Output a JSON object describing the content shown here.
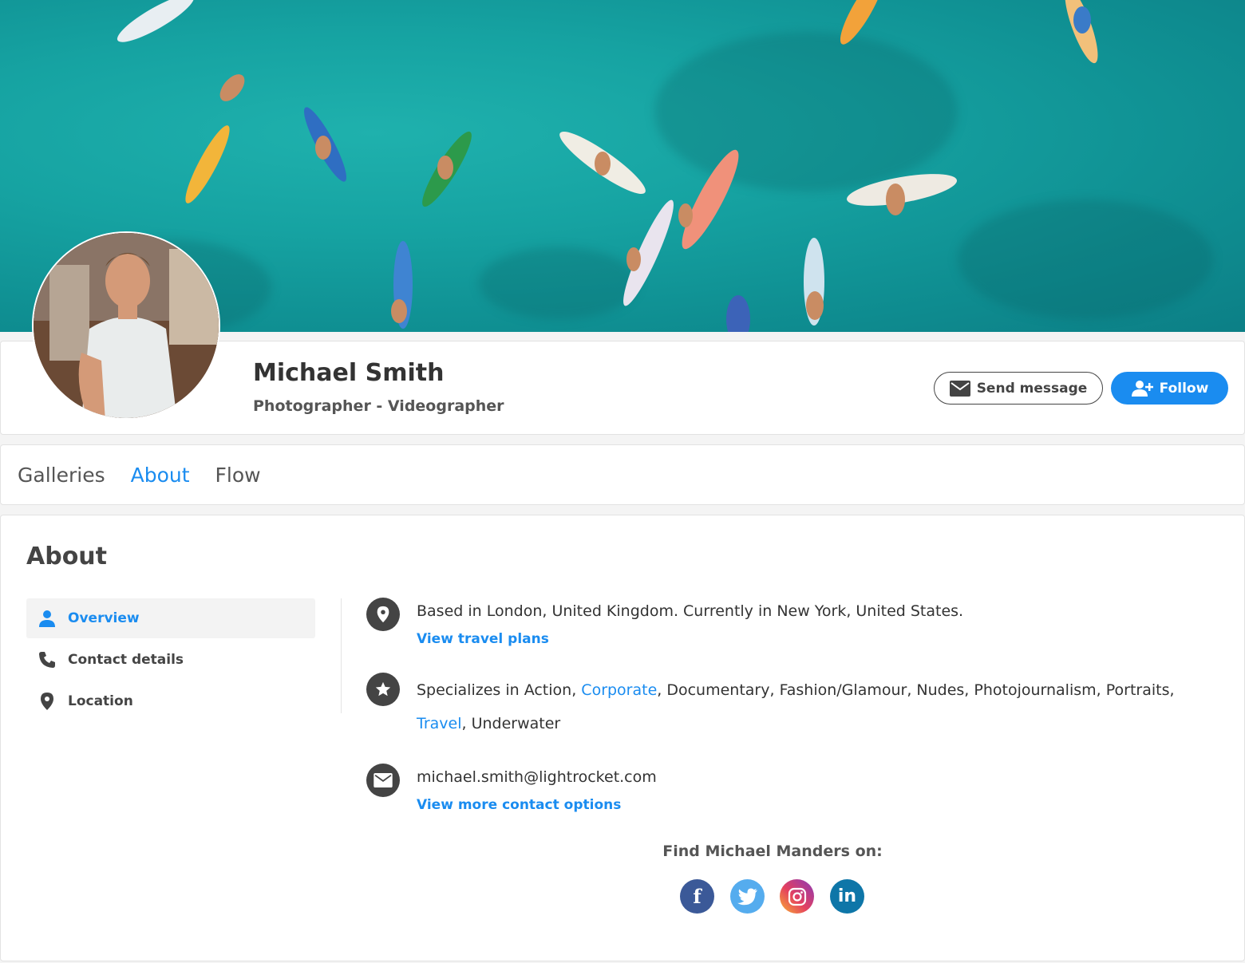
{
  "profile": {
    "name": "Michael Smith",
    "role": "Photographer - Videographer",
    "send_message_label": "Send message",
    "follow_label": "Follow"
  },
  "tabs": [
    {
      "label": "Galleries",
      "active": false
    },
    {
      "label": "About",
      "active": true
    },
    {
      "label": "Flow",
      "active": false
    }
  ],
  "about": {
    "title": "About",
    "sidebar": [
      {
        "label": "Overview",
        "icon": "person-icon",
        "active": true
      },
      {
        "label": "Contact details",
        "icon": "phone-icon",
        "active": false
      },
      {
        "label": "Location",
        "icon": "location-pin-icon",
        "active": false
      }
    ],
    "location_text": "Based in London, United Kingdom. Currently in New York, United States.",
    "travel_link": "View travel plans",
    "specializes_prefix": "Specializes in  Action, ",
    "spec_corporate": "Corporate",
    "spec_middle": ", Documentary, Fashion/Glamour, Nudes, Photojournalism, Portraits,",
    "spec_travel": "Travel",
    "spec_end": ", Underwater",
    "email": "michael.smith@lightrocket.com",
    "contact_link": "View more contact options",
    "find_label": "Find Michael Manders on:",
    "social": [
      "facebook-icon",
      "twitter-icon",
      "instagram-icon",
      "linkedin-icon"
    ]
  },
  "colors": {
    "accent": "#1a8cf0",
    "facebook": "#3b5998",
    "twitter": "#55acee",
    "linkedin": "#0e76a8"
  }
}
